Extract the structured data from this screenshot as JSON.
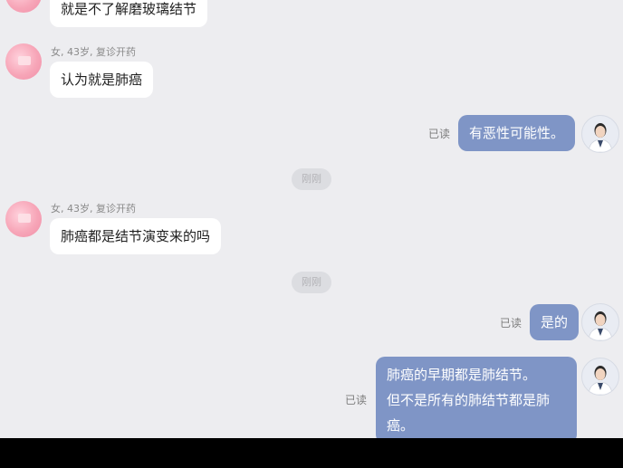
{
  "messages": {
    "patient_msg_1": "就是不了解磨玻璃结节",
    "patient_meta_1": "女, 43岁, 复诊开药",
    "patient_msg_2": "认为就是肺癌",
    "doctor_msg_1": "有恶性可能性。",
    "time_1": "刚刚",
    "patient_meta_2": "女, 43岁, 复诊开药",
    "patient_msg_3": "肺癌都是结节演变来的吗",
    "time_2": "刚刚",
    "doctor_msg_2": "是的",
    "doctor_msg_3_line1": "肺癌的早期都是肺结节。",
    "doctor_msg_3_line2": "但不是所有的肺结节都是肺",
    "doctor_msg_3_line3": "癌。"
  },
  "read_status": "已读",
  "colors": {
    "background": "#ededf0",
    "doctor_bubble": "#7f95c6",
    "patient_bubble": "#ffffff",
    "patient_avatar": "#f7a6b8"
  }
}
